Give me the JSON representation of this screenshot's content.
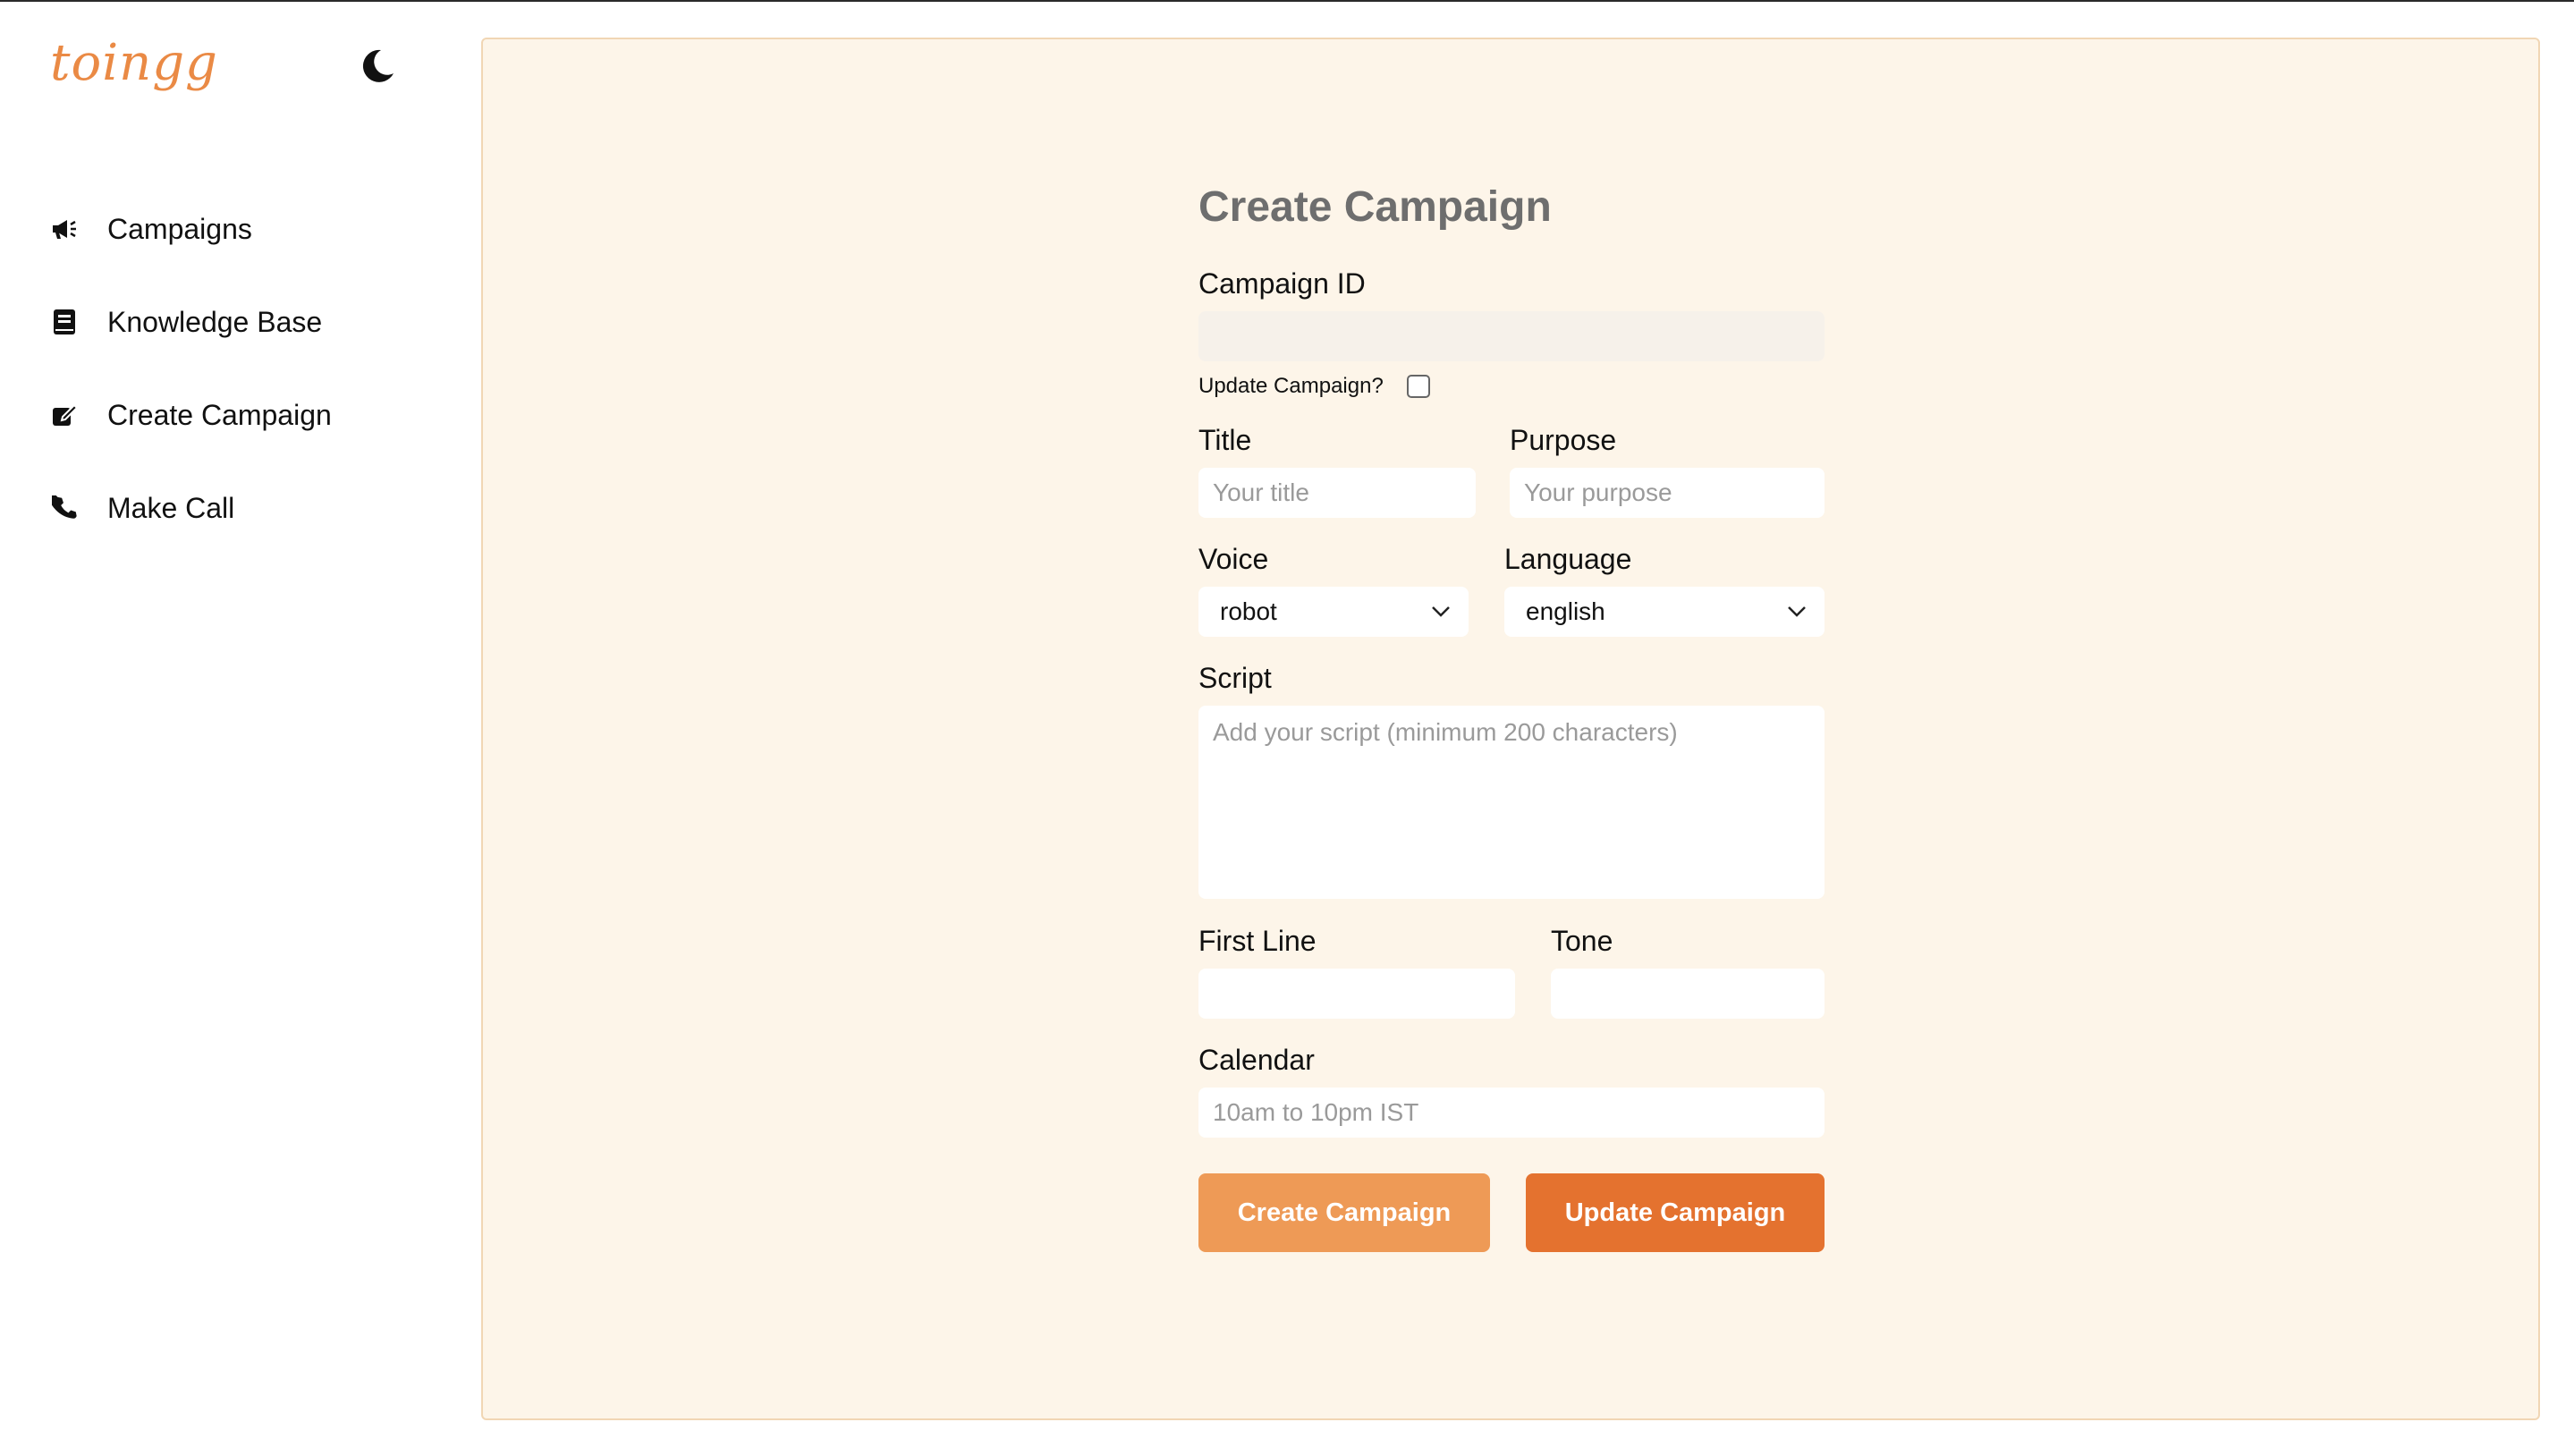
{
  "app": {
    "logo_text": "toingg",
    "accent_color": "#ea8a45",
    "theme_icon": "moon-icon"
  },
  "sidebar": {
    "items": [
      {
        "label": "Campaigns",
        "icon": "megaphone-icon"
      },
      {
        "label": "Knowledge Base",
        "icon": "book-icon"
      },
      {
        "label": "Create Campaign",
        "icon": "edit-icon"
      },
      {
        "label": "Make Call",
        "icon": "phone-icon"
      }
    ]
  },
  "form": {
    "title": "Create Campaign",
    "campaign_id": {
      "label": "Campaign ID",
      "value": ""
    },
    "update_checkbox": {
      "label": "Update Campaign?",
      "checked": false
    },
    "title_field": {
      "label": "Title",
      "placeholder": "Your title"
    },
    "purpose_field": {
      "label": "Purpose",
      "placeholder": "Your purpose"
    },
    "voice": {
      "label": "Voice",
      "value": "robot"
    },
    "language": {
      "label": "Language",
      "value": "english"
    },
    "script": {
      "label": "Script",
      "placeholder": "Add your script (minimum 200 characters)"
    },
    "first_line": {
      "label": "First Line",
      "value": ""
    },
    "tone": {
      "label": "Tone",
      "value": ""
    },
    "calendar": {
      "label": "Calendar",
      "placeholder": "10am to 10pm IST"
    },
    "create_button": "Create Campaign",
    "update_button": "Update Campaign"
  }
}
